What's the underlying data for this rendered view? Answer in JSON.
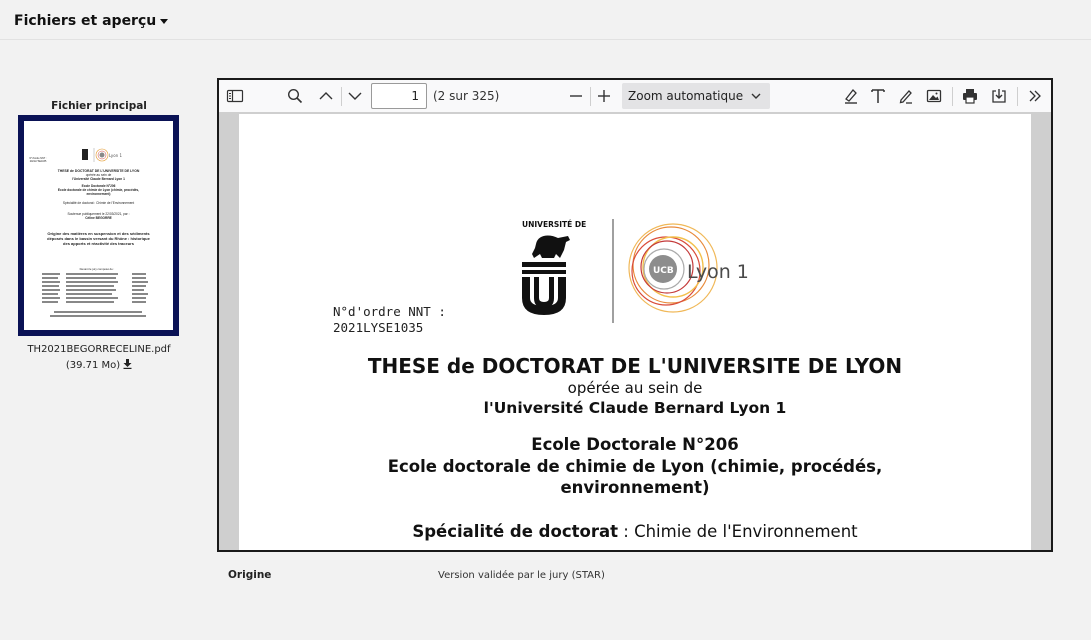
{
  "section": {
    "title": "Fichiers et aperçu"
  },
  "file": {
    "label": "Fichier principal",
    "filename": "TH2021BEGORRECELINE.pdf",
    "size": "(39.71 Mo)"
  },
  "thumbnail": {
    "nnt": "N°d'ordre NNT :\n2021LYSE1035",
    "title": "THESE de DOCTORAT DE L'UNIVERSITE DE LYON",
    "subtitle1": "opérée au sein de",
    "subtitle2": "l'Université Claude Bernard Lyon 1",
    "ecole1": "Ecole Doctorale N°206",
    "ecole2": "Ecole doctorale de chimie de Lyon (chimie, procédés, environnement)",
    "specialite": "Spécialité de doctorat : Chimie de l'Environnement",
    "soutenue": "Soutenue publiquement le 22/03/2021, par :",
    "author": "Céline BEGORRE",
    "thesis_title": "Origine des matières en suspension et des sédiments déposés dans le bassin versant du Rhône : historique des apports et réactivité des traceurs",
    "jury": "Devant le jury composé de :"
  },
  "viewer": {
    "page_number": "1",
    "page_count": "(2 sur 325)",
    "zoom": "Zoom automatique",
    "icons": {
      "sidebar": "sidebar-toggle-icon",
      "search": "search-icon",
      "prev": "chevron-up-icon",
      "next": "chevron-down-icon",
      "zoom_out": "minus-icon",
      "zoom_in": "plus-icon",
      "highlight": "highlight-icon",
      "text": "text-icon",
      "draw": "draw-icon",
      "image": "image-icon",
      "print": "print-icon",
      "save": "save-icon",
      "more": "double-chevron-right-icon"
    }
  },
  "document": {
    "nnt_label": "N°d'ordre NNT :",
    "nnt_value": "2021LYSE1035",
    "title": "THESE de DOCTORAT DE L'UNIVERSITE DE LYON",
    "subtitle1": "opérée au sein de",
    "subtitle2": "l'Université Claude Bernard Lyon 1",
    "ecole_number": "Ecole Doctorale N°206",
    "ecole_name_line1": "Ecole doctorale de chimie de Lyon (chimie, procédés,",
    "ecole_name_line2": "environnement)",
    "specialite_label": "Spécialité de doctorat",
    "specialite_sep": " : ",
    "specialite_value": "Chimie de l'Environnement",
    "logo_left": "UNIVERSITÉ DE LYON",
    "logo_right": "Lyon 1",
    "logo_right_mark": "UCB"
  },
  "metadata": {
    "label": "Origine",
    "value": "Version validée par le jury (STAR)"
  }
}
